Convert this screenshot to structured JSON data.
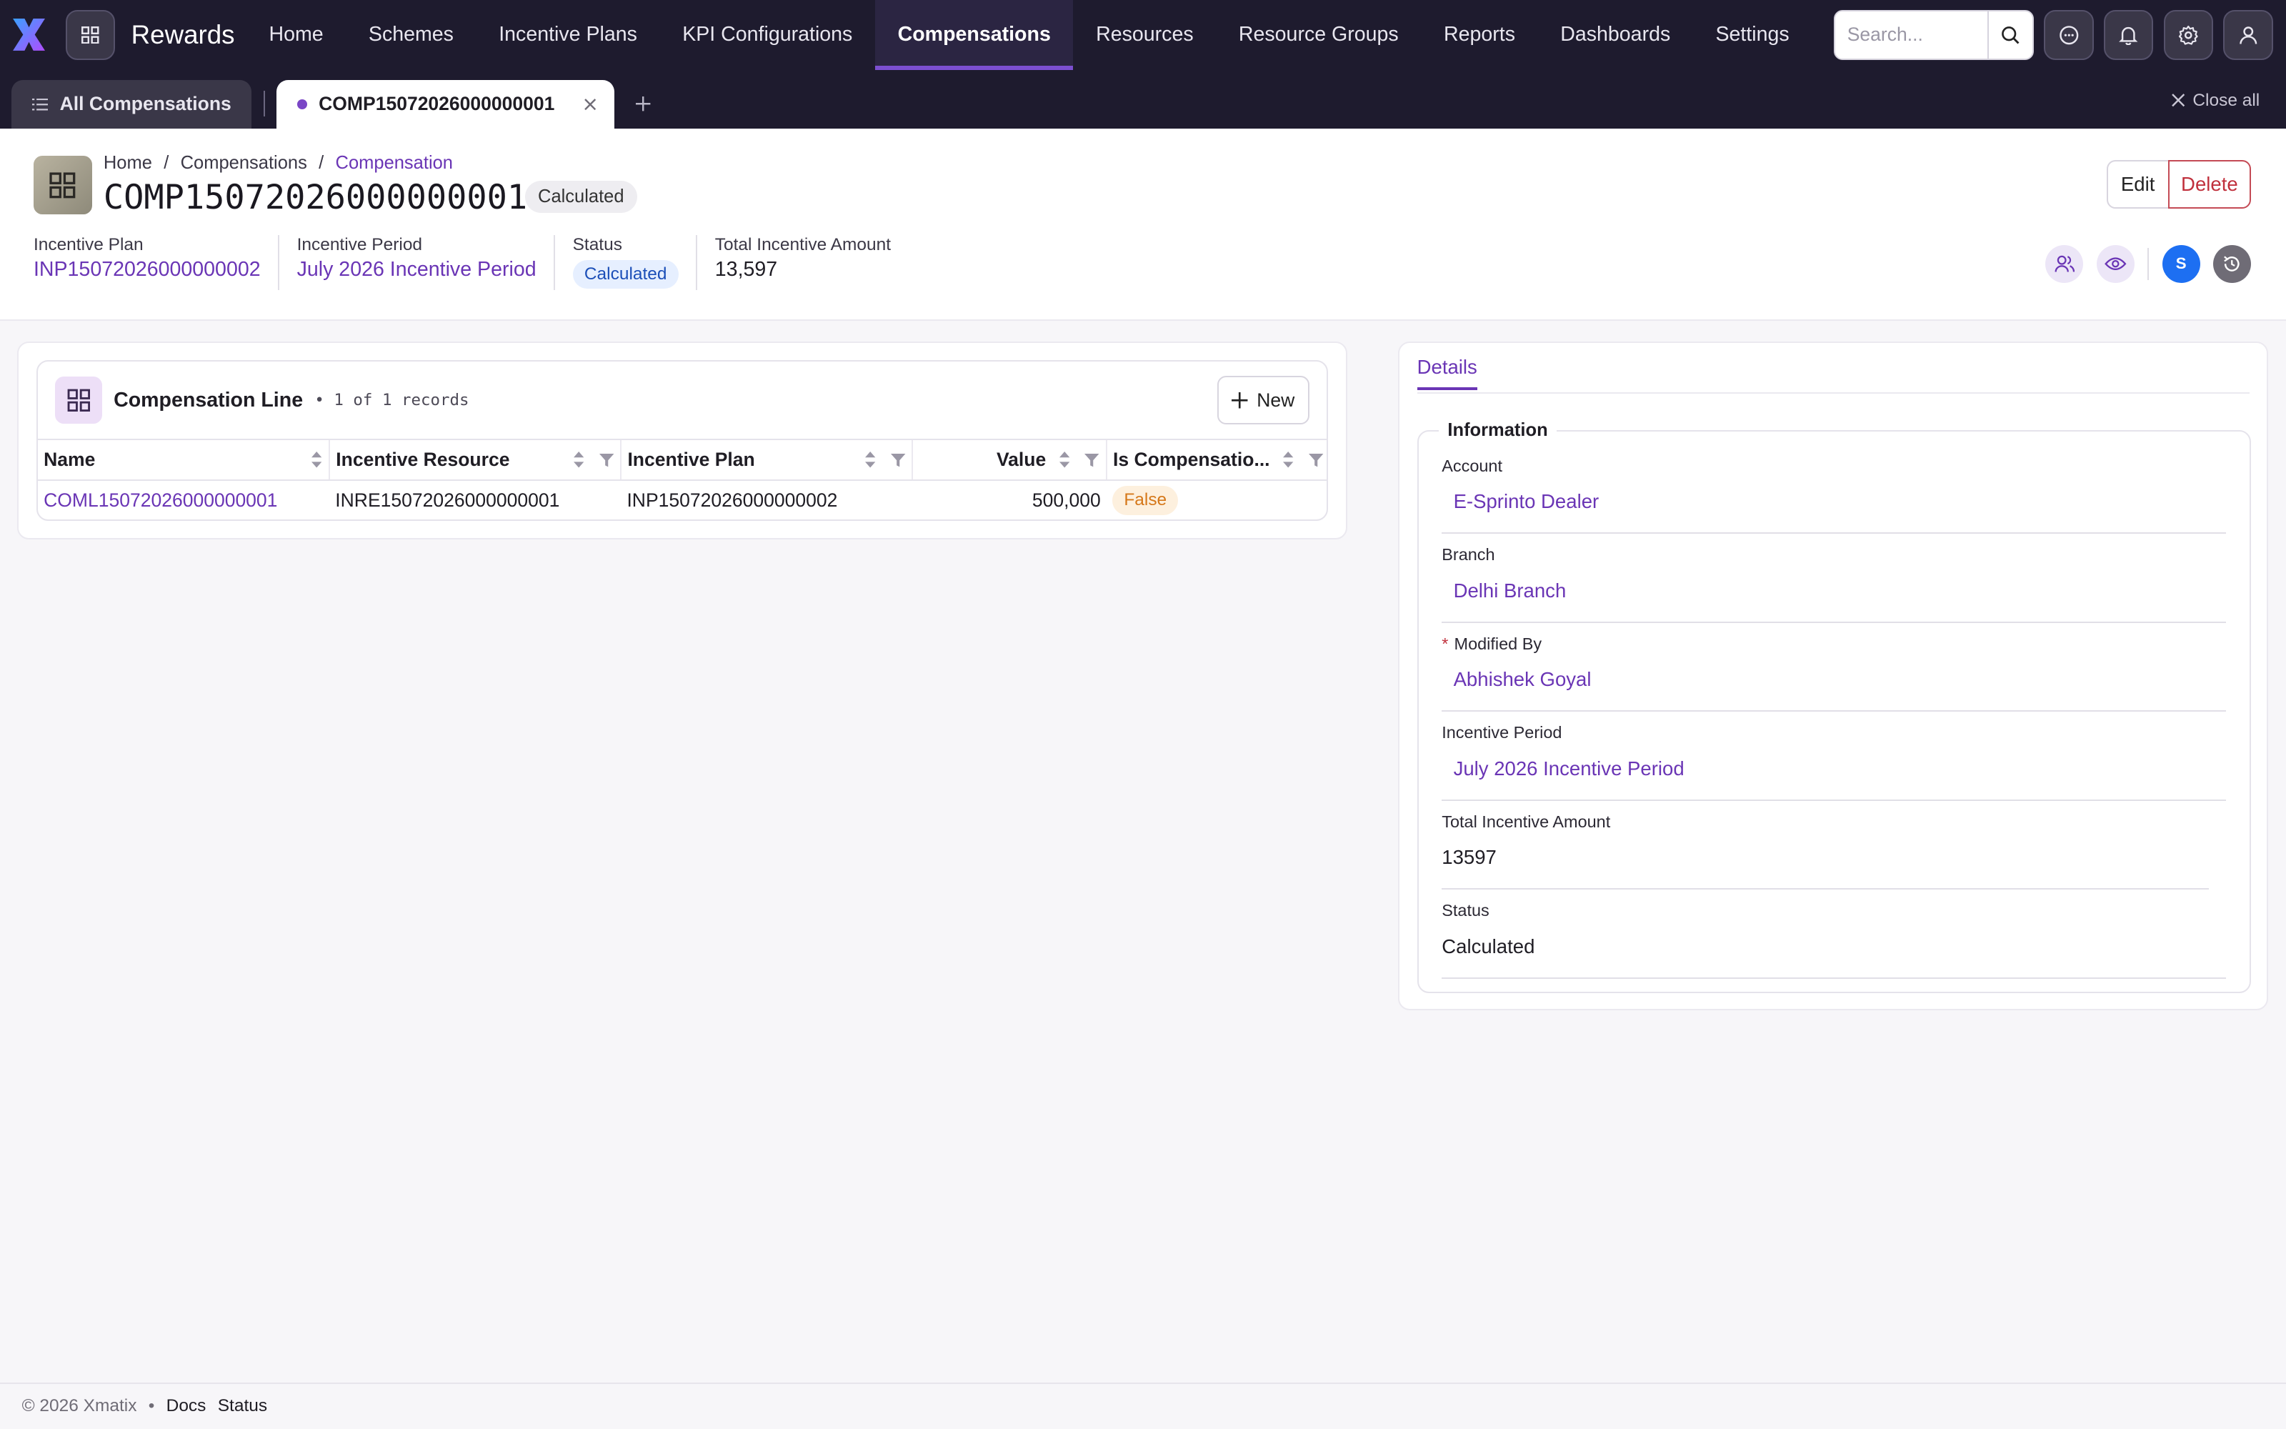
{
  "nav": {
    "app_title": "Rewards",
    "items": [
      "Home",
      "Schemes",
      "Incentive Plans",
      "KPI Configurations",
      "Compensations",
      "Resources",
      "Resource Groups",
      "Reports",
      "Dashboards",
      "Settings"
    ],
    "active": "Compensations",
    "search_placeholder": "Search...",
    "icons": [
      "search-icon",
      "chat-icon",
      "bell-icon",
      "gear-icon",
      "user-icon"
    ]
  },
  "tabs": {
    "all_label": "All Compensations",
    "active_label": "COMP15072026000000001",
    "close_all": "Close all"
  },
  "record": {
    "breadcrumb": [
      "Home",
      "Compensations",
      "Compensation"
    ],
    "title": "COMP15072026000000001",
    "status_pill": "Calculated",
    "edit_label": "Edit",
    "delete_label": "Delete",
    "meta": {
      "incentive_plan_label": "Incentive Plan",
      "incentive_plan": "INP15072026000000002",
      "incentive_period_label": "Incentive Period",
      "incentive_period": "July 2026 Incentive Period",
      "status_label": "Status",
      "status": "Calculated",
      "total_label": "Total Incentive Amount",
      "total": "13,597"
    },
    "avatar_initial": "S"
  },
  "comp_line": {
    "title": "Compensation Line",
    "count": "• 1 of 1 records",
    "new_label": "New",
    "columns": [
      "Name",
      "Incentive Resource",
      "Incentive Plan",
      "Value",
      "Is Compensatio..."
    ],
    "rows": [
      {
        "name": "COML15072026000000001",
        "resource": "INRE15072026000000001",
        "plan": "INP15072026000000002",
        "value": "500,000",
        "is_comp": "False"
      }
    ]
  },
  "details": {
    "tab": "Details",
    "section": "Information",
    "fields": {
      "account_label": "Account",
      "account": "E-Sprinto Dealer",
      "branch_label": "Branch",
      "branch": "Delhi Branch",
      "modified_by_label": "Modified By",
      "modified_by": "Abhishek Goyal",
      "period_label": "Incentive Period",
      "period": "July 2026 Incentive Period",
      "total_label": "Total Incentive Amount",
      "total": "13597",
      "status_label": "Status",
      "status": "Calculated"
    }
  },
  "footer": {
    "copyright": "© 2026 Xmatix",
    "dot": "•",
    "links": [
      "Docs",
      "Status"
    ]
  },
  "colors": {
    "nav_bg": "#1e1b2e",
    "accent": "#6a35b5",
    "danger": "#c0303c",
    "status_blue": "#1c4fb8",
    "false_orange": "#d5781a"
  }
}
